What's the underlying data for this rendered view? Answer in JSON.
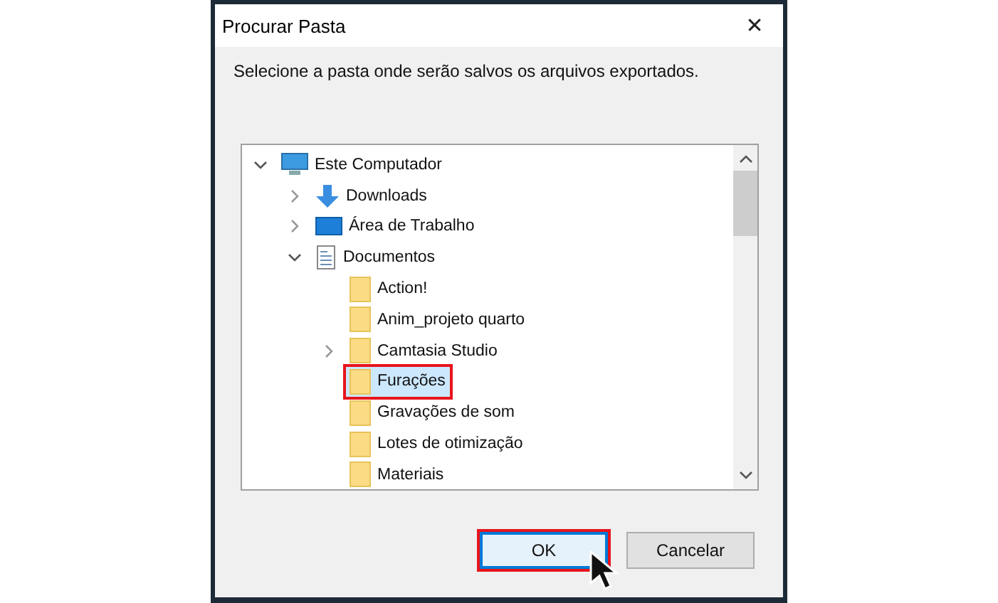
{
  "window": {
    "title": "Procurar Pasta",
    "close": "✕"
  },
  "instruction": "Selecione a pasta onde serão salvos os arquivos exportados.",
  "tree": {
    "items": [
      {
        "label": "Este Computador",
        "kind": "computer",
        "expandable": true,
        "expanded": true,
        "selected": false,
        "annotated": false,
        "children": [
          {
            "label": "Downloads",
            "kind": "download",
            "expandable": true,
            "expanded": false,
            "selected": false,
            "annotated": false
          },
          {
            "label": "Área de Trabalho",
            "kind": "desktop",
            "expandable": true,
            "expanded": false,
            "selected": false,
            "annotated": false
          },
          {
            "label": "Documentos",
            "kind": "document",
            "expandable": true,
            "expanded": true,
            "selected": false,
            "annotated": false,
            "children": [
              {
                "label": "Action!",
                "kind": "folder",
                "expandable": false,
                "selected": false,
                "annotated": false
              },
              {
                "label": "Anim_projeto quarto",
                "kind": "folder",
                "expandable": false,
                "selected": false,
                "annotated": false
              },
              {
                "label": "Camtasia Studio",
                "kind": "folder",
                "expandable": true,
                "expanded": false,
                "selected": false,
                "annotated": false
              },
              {
                "label": "Furações",
                "kind": "folder",
                "expandable": false,
                "selected": true,
                "annotated": true
              },
              {
                "label": "Gravações de som",
                "kind": "folder",
                "expandable": false,
                "selected": false,
                "annotated": false
              },
              {
                "label": "Lotes de otimização",
                "kind": "folder",
                "expandable": false,
                "selected": false,
                "annotated": false
              },
              {
                "label": "Materiais",
                "kind": "folder",
                "expandable": false,
                "selected": false,
                "annotated": false
              }
            ]
          }
        ]
      }
    ]
  },
  "buttons": [
    {
      "label": "OK",
      "default": true,
      "annotated": true
    },
    {
      "label": "Cancelar",
      "default": false,
      "annotated": false
    }
  ]
}
